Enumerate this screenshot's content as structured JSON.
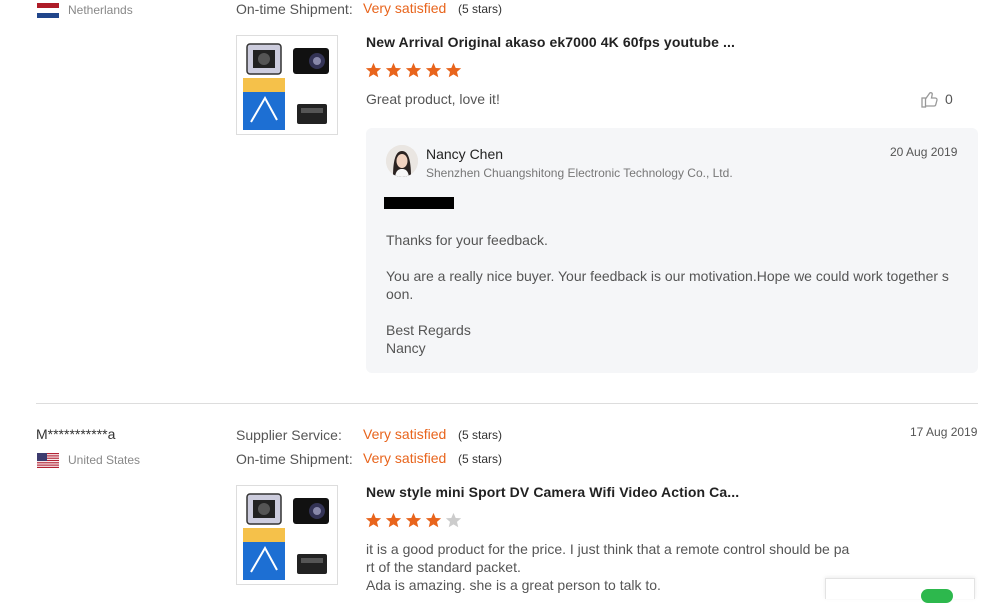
{
  "review1": {
    "country": "Netherlands",
    "shipment_label": "On-time Shipment:",
    "shipment_value": "Very satisfied",
    "shipment_stars": "(5 stars)",
    "product_title": "New Arrival Original akaso ek7000 4K 60fps youtube ...",
    "rating": 5,
    "text": "Great product, love it!",
    "like_count": "0",
    "reply": {
      "name": "Nancy Chen",
      "company": "Shenzhen Chuangshitong Electronic Technology Co., Ltd.",
      "date": "20 Aug 2019",
      "line1": "Thanks for your feedback.",
      "line2a": "You are a really nice buyer. Your feedback is our motivation.Hope we could work together s",
      "line2b": "oon.",
      "line3": "Best Regards",
      "line4": "Nancy"
    }
  },
  "review2": {
    "reviewer": "M***********a",
    "country": "United States",
    "date": "17 Aug 2019",
    "supplier_label": "Supplier Service:",
    "supplier_value": "Very satisfied",
    "supplier_stars": "(5 stars)",
    "shipment_label": "On-time Shipment:",
    "shipment_value": "Very satisfied",
    "shipment_stars": "(5 stars)",
    "product_title": "New style mini Sport DV Camera Wifi Video Action Ca...",
    "rating": 4,
    "text_line1": "it is a good product for the price. I just think that a remote control should be pa",
    "text_line2": "rt of the standard packet.",
    "text_line3": "Ada is amazing. she is a great person to talk to."
  },
  "colors": {
    "accent": "#e8641c",
    "star_empty": "#cccccc",
    "reply_bg": "#f5f6f8",
    "toggle": "#2db84d"
  }
}
